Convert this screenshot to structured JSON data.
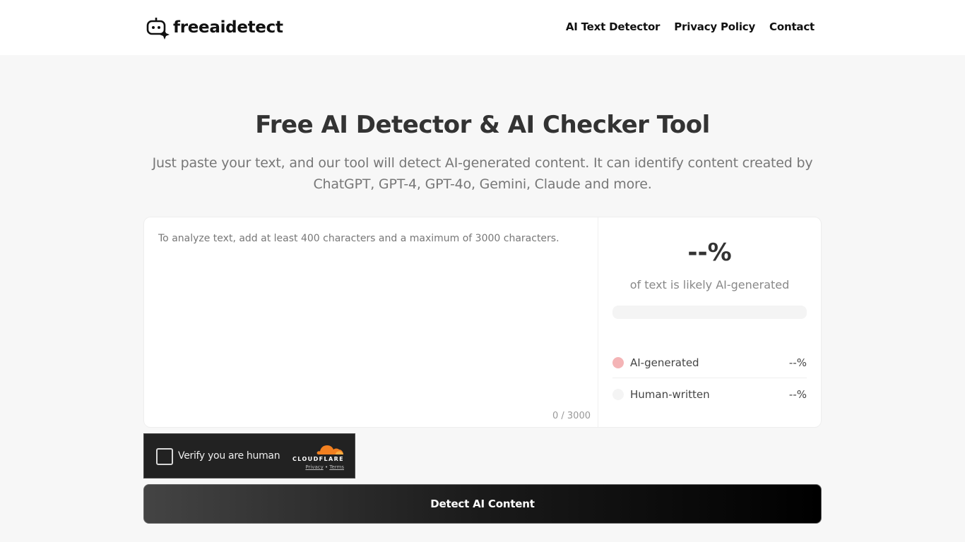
{
  "header": {
    "logo_text": "freeaidetect",
    "nav": [
      {
        "label": "AI Text Detector"
      },
      {
        "label": "Privacy Policy"
      },
      {
        "label": "Contact"
      }
    ]
  },
  "hero": {
    "title": "Free AI Detector & AI Checker Tool",
    "subtitle": "Just paste your text, and our tool will detect AI-generated content. It can identify content created by ChatGPT, GPT-4, GPT-4o, Gemini, Claude and more."
  },
  "input": {
    "value": "",
    "placeholder": "To analyze text, add at least 400 characters and a maximum of 3000 characters.",
    "counter": "0 / 3000"
  },
  "result": {
    "percentage": "--%",
    "caption": "of text is likely AI-generated",
    "progress_percent": 0,
    "legend": [
      {
        "label": "AI-generated",
        "value": "--%",
        "color": "#f4b4b6"
      },
      {
        "label": "Human-written",
        "value": "--%",
        "color": "#f4f4f4"
      }
    ]
  },
  "captcha": {
    "label": "Verify you are human",
    "brand": "CLOUDFLARE",
    "privacy_link": "Privacy",
    "separator": "•",
    "terms_link": "Terms",
    "brand_color": "#f38020"
  },
  "actions": {
    "detect_label": "Detect AI Content"
  }
}
